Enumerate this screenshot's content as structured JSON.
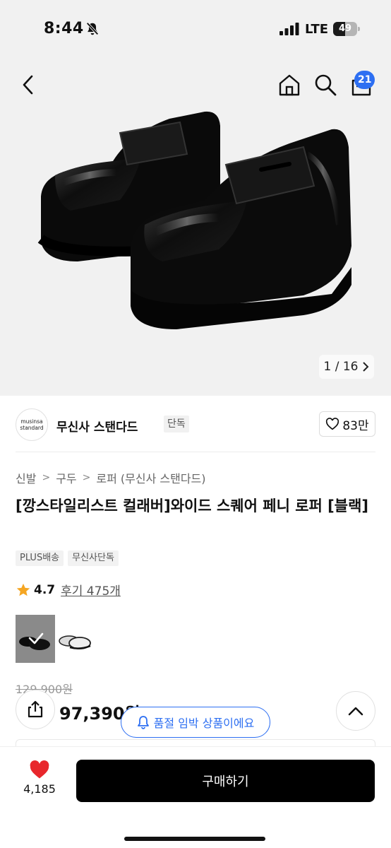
{
  "status_bar": {
    "time": "8:44",
    "network": "LTE",
    "battery_level": "49",
    "battery_fraction": 0.49
  },
  "header": {
    "back_icon": "chevron-left-icon",
    "home_icon": "home-icon",
    "search_icon": "search-icon",
    "cart_icon": "bag-icon",
    "cart_count": "21",
    "accent_color": "#2d6ff2"
  },
  "gallery": {
    "counter": "1 / 16",
    "next_icon": "chevron-right-icon"
  },
  "brand": {
    "logo_line1": "musinsa",
    "logo_line2": "standard",
    "name": "무신사 스탠다드",
    "badge": "단독",
    "like_count": "83만",
    "like_icon": "heart-outline-icon"
  },
  "breadcrumb": {
    "items": [
      "신발",
      "구두",
      "로퍼 (무신사 스탠다드)"
    ],
    "separator": ">"
  },
  "product": {
    "title": "[깡스타일리스트 컬래버]와이드 스퀘어 페니 로퍼 [블랙]",
    "tags": [
      "PLUS배송",
      "무신사단독"
    ],
    "rating": "4.7",
    "review_text": "후기 475개",
    "original_price": "129,900원",
    "price": "97,390원",
    "stock_notice": "품절 임박 상품이에요"
  },
  "bottom_bar": {
    "wish_count": "4,185",
    "buy_label": "구매하기",
    "heart_color": "#e8272c"
  }
}
